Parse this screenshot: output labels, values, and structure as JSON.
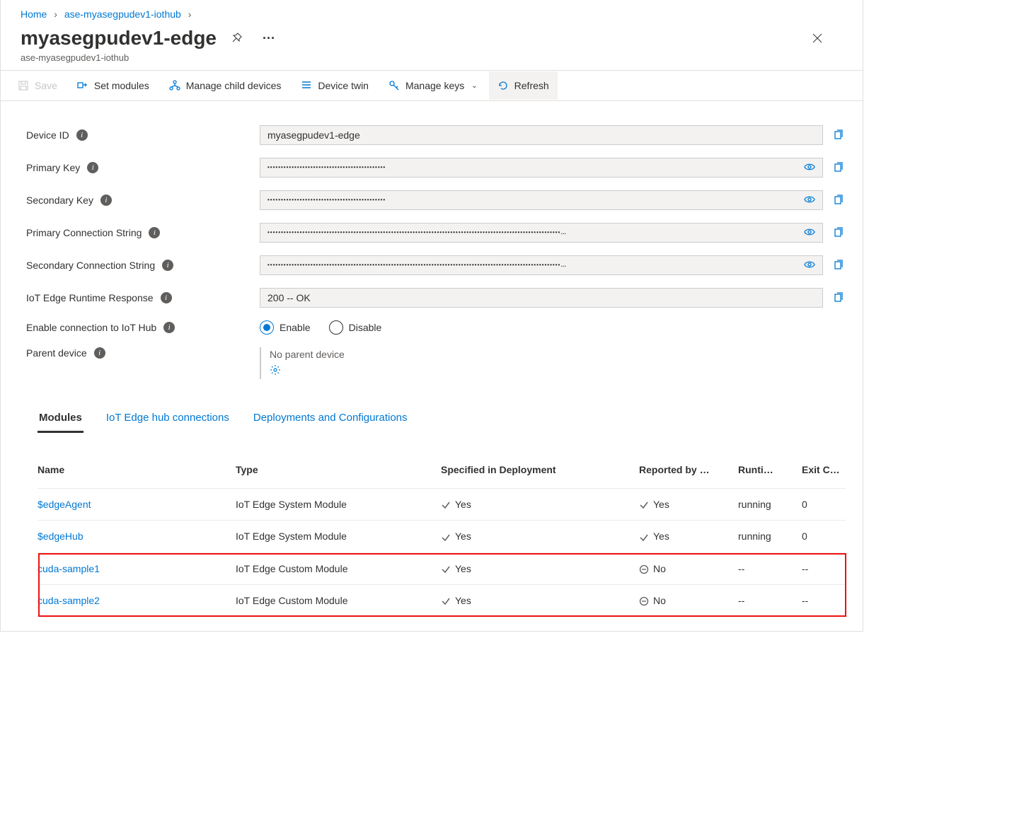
{
  "breadcrumb": {
    "home": "Home",
    "parent": "ase-myasegpudev1-iothub"
  },
  "header": {
    "title": "myasegpudev1-edge",
    "subtitle": "ase-myasegpudev1-iothub"
  },
  "commands": {
    "save": "Save",
    "set_modules": "Set modules",
    "manage_child": "Manage child devices",
    "device_twin": "Device twin",
    "manage_keys": "Manage keys",
    "refresh": "Refresh"
  },
  "form": {
    "device_id_label": "Device ID",
    "device_id_value": "myasegpudev1-edge",
    "primary_key_label": "Primary Key",
    "primary_key_mask": "••••••••••••••••••••••••••••••••••••••••••••",
    "secondary_key_label": "Secondary Key",
    "secondary_key_mask": "••••••••••••••••••••••••••••••••••••••••••••",
    "primary_conn_label": "Primary Connection String",
    "primary_conn_mask": "•••••••••••••••••••••••••••••••••••••••••••••••••••••••••••••••••••••••••••••••••••••••••••••••••••••••••••••…",
    "secondary_conn_label": "Secondary Connection String",
    "secondary_conn_mask": "•••••••••••••••••••••••••••••••••••••••••••••••••••••••••••••••••••••••••••••••••••••••••••••••••••••••••••••…",
    "runtime_label": "IoT Edge Runtime Response",
    "runtime_value": "200 -- OK",
    "enable_conn_label": "Enable connection to IoT Hub",
    "enable_opt": "Enable",
    "disable_opt": "Disable",
    "parent_label": "Parent device",
    "parent_value": "No parent device"
  },
  "tabs": {
    "modules": "Modules",
    "hub_conn": "IoT Edge hub connections",
    "deployments": "Deployments and Configurations"
  },
  "table": {
    "headers": {
      "name": "Name",
      "type": "Type",
      "specified": "Specified in Deployment",
      "reported": "Reported by …",
      "runtime": "Runti…",
      "exit": "Exit C…"
    },
    "rows": [
      {
        "name": "$edgeAgent",
        "type": "IoT Edge System Module",
        "specified": "Yes",
        "spec_icon": "check",
        "reported": "Yes",
        "rep_icon": "check",
        "runtime": "running",
        "exit": "0",
        "highlight": false
      },
      {
        "name": "$edgeHub",
        "type": "IoT Edge System Module",
        "specified": "Yes",
        "spec_icon": "check",
        "reported": "Yes",
        "rep_icon": "check",
        "runtime": "running",
        "exit": "0",
        "highlight": false
      },
      {
        "name": "cuda-sample1",
        "type": "IoT Edge Custom Module",
        "specified": "Yes",
        "spec_icon": "check",
        "reported": "No",
        "rep_icon": "minus",
        "runtime": "--",
        "exit": "--",
        "highlight": true
      },
      {
        "name": "cuda-sample2",
        "type": "IoT Edge Custom Module",
        "specified": "Yes",
        "spec_icon": "check",
        "reported": "No",
        "rep_icon": "minus",
        "runtime": "--",
        "exit": "--",
        "highlight": true
      }
    ]
  }
}
